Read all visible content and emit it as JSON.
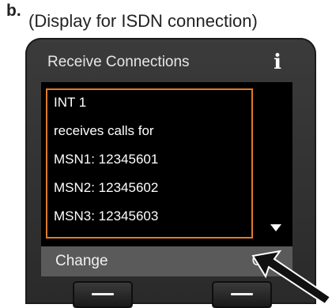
{
  "figure": {
    "label": "b.",
    "caption": "(Display for ISDN connection)"
  },
  "display": {
    "title": "Receive Connections",
    "info_icon": "i",
    "lines": [
      "INT 1",
      "receives calls for",
      "MSN1: 12345601",
      "MSN2: 12345602",
      "MSN3: 12345603"
    ],
    "softkeys": {
      "left": "Change",
      "right": "OK"
    }
  },
  "colors": {
    "highlight_border": "#e07a2a",
    "screen_bg": "#000000",
    "device_bg": "#333333"
  },
  "icons": [
    "info-icon",
    "scroll-down-icon",
    "pointer-arrow-icon"
  ]
}
